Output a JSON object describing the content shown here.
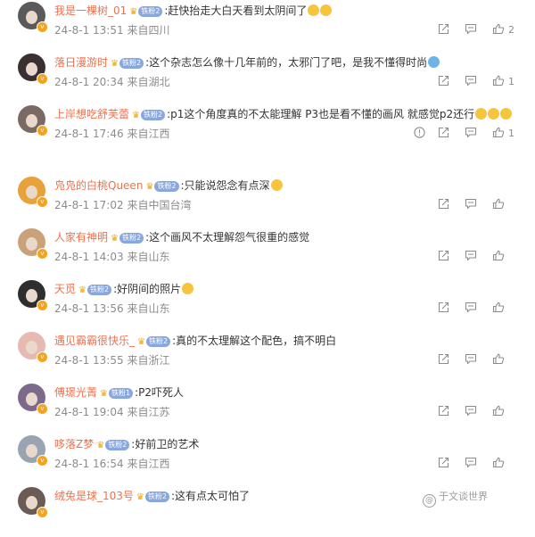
{
  "comments": [
    {
      "username": "我是一棵树_01",
      "fan_badge": "铁粉2",
      "text": ":赶快抬走大白天看到太阴间了",
      "emojis": 2,
      "emoji_color": "#f6c43d",
      "date": "24-8-1",
      "time": "13:51",
      "location": "来自四川",
      "likes": "2",
      "avatar_color": "#5a5a5a",
      "actions": [
        "share",
        "reply",
        "like"
      ]
    },
    {
      "username": "落日漫游时",
      "fan_badge": "铁粉2",
      "text": ":这个杂志怎么像十几年前的，太邪门了吧，是我不懂得时尚",
      "emojis": 1,
      "emoji_color": "#6fb3e6",
      "date": "24-8-1",
      "time": "20:34",
      "location": "来自湖北",
      "likes": "1",
      "avatar_color": "#3a3032",
      "actions": [
        "share",
        "reply",
        "like"
      ]
    },
    {
      "username": "上岸想吃舒芙蕾",
      "fan_badge": "铁粉2",
      "text": ":p1这个角度真的不太能理解  P3也是看不懂的画风 就感觉p2还行",
      "emojis": 3,
      "emoji_color": "#f6c43d",
      "date": "24-8-1",
      "time": "17:46",
      "location": "来自江西",
      "likes": "1",
      "avatar_color": "#7a6a64",
      "actions": [
        "report",
        "share",
        "reply",
        "like"
      ]
    },
    {
      "username": "凫凫的白桃Queen",
      "fan_badge": "铁粉2",
      "text": ":只能说怨念有点深",
      "emojis": 1,
      "emoji_color": "#f6c43d",
      "date": "24-8-1",
      "time": "17:02",
      "location": "来自中国台湾",
      "likes": "",
      "avatar_color": "#e8a23c",
      "actions": [
        "share",
        "reply",
        "like"
      ]
    },
    {
      "username": "人家有神明",
      "fan_badge": "铁粉2",
      "text": ":这个画风不太理解怨气很重的感觉",
      "emojis": 0,
      "emoji_color": "#f6c43d",
      "date": "24-8-1",
      "time": "14:03",
      "location": "来自山东",
      "likes": "",
      "avatar_color": "#c9a27a",
      "actions": [
        "share",
        "reply",
        "like"
      ]
    },
    {
      "username": "天觅",
      "fan_badge": "铁粉2",
      "text": ":好阴间的照片",
      "emojis": 1,
      "emoji_color": "#f6c43d",
      "date": "24-8-1",
      "time": "13:56",
      "location": "来自山东",
      "likes": "",
      "avatar_color": "#2e2e2e",
      "actions": [
        "share",
        "reply",
        "like"
      ]
    },
    {
      "username": "遇见霸霸很快乐_",
      "fan_badge": "铁粉2",
      "text": ":真的不太理解这个配色，搞不明白",
      "emojis": 0,
      "emoji_color": "#f6c43d",
      "date": "24-8-1",
      "time": "13:55",
      "location": "来自浙江",
      "likes": "",
      "avatar_color": "#e7b9b3",
      "actions": [
        "share",
        "reply",
        "like"
      ]
    },
    {
      "username": "傅璟光菁",
      "fan_badge": "铁粉1",
      "text": ":P2吓死人",
      "emojis": 0,
      "emoji_color": "#f6c43d",
      "date": "24-8-1",
      "time": "19:04",
      "location": "来自江苏",
      "likes": "",
      "avatar_color": "#7d6a8a",
      "actions": [
        "share",
        "reply",
        "like"
      ]
    },
    {
      "username": "哆落Z梦",
      "fan_badge": "铁粉2",
      "text": ":好前卫的艺术",
      "emojis": 0,
      "emoji_color": "#f6c43d",
      "date": "24-8-1",
      "time": "16:54",
      "location": "来自江西",
      "likes": "",
      "avatar_color": "#9aa3b0",
      "actions": [
        "share",
        "reply",
        "like"
      ]
    },
    {
      "username": "绒兔是球_103号",
      "fan_badge": "铁粉2",
      "text": ":这有点太可怕了",
      "emojis": 0,
      "emoji_color": "#f6c43d",
      "date": "",
      "time": "",
      "location": "",
      "likes": "",
      "avatar_color": "#6b5b55",
      "actions": []
    }
  ],
  "watermark": {
    "text": "于文谈世界",
    "icon": "speech-bubble-icon"
  }
}
